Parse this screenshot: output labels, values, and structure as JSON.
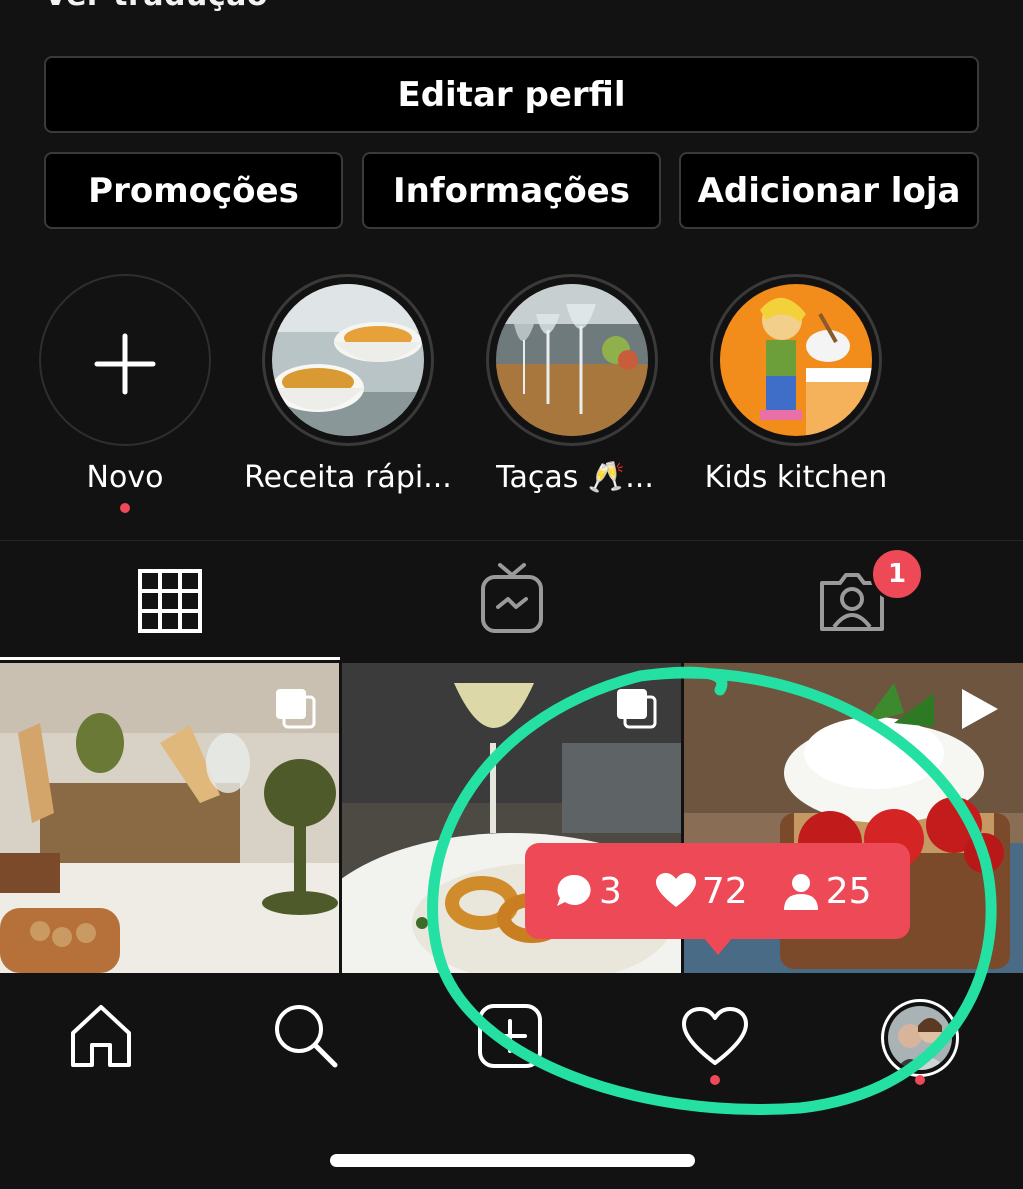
{
  "profile": {
    "see_translation": "Ver tradução"
  },
  "buttons": {
    "edit_profile": "Editar perfil",
    "promotions": "Promoções",
    "insights": "Informações",
    "add_shop": "Adicionar loja"
  },
  "highlights": [
    {
      "label": "Novo",
      "icon": "plus-icon",
      "has_dot": true
    },
    {
      "label": "Receita rápi...",
      "icon": "food-bowls-image"
    },
    {
      "label": "Taças 🥂...",
      "icon": "wine-glasses-image"
    },
    {
      "label": "Kids kitchen",
      "icon": "kids-cartoon-image"
    }
  ],
  "tabs": [
    {
      "name": "grid",
      "icon": "grid-icon",
      "active": true
    },
    {
      "name": "igtv",
      "icon": "igtv-icon"
    },
    {
      "name": "tagged",
      "icon": "tagged-person-icon",
      "badge": "1"
    }
  ],
  "posts": [
    {
      "icon": "carousel-icon",
      "alt": "table with bread and green glasses"
    },
    {
      "icon": "carousel-icon",
      "alt": "fried calamari plate with wine"
    },
    {
      "icon": "video-play-icon",
      "alt": "burrata with cherry tomatoes on toast"
    }
  ],
  "activity_tooltip": {
    "comments": "3",
    "likes": "72",
    "followers": "25"
  },
  "bottom_nav": [
    {
      "name": "home",
      "icon": "home-icon"
    },
    {
      "name": "search",
      "icon": "search-icon"
    },
    {
      "name": "new-post",
      "icon": "plus-square-icon"
    },
    {
      "name": "activity",
      "icon": "heart-icon",
      "has_dot": true
    },
    {
      "name": "profile",
      "icon": "avatar",
      "has_dot": true
    }
  ],
  "colors": {
    "background": "#121212",
    "accent_red": "#ed4956",
    "annotation_green": "#25e0a3"
  }
}
